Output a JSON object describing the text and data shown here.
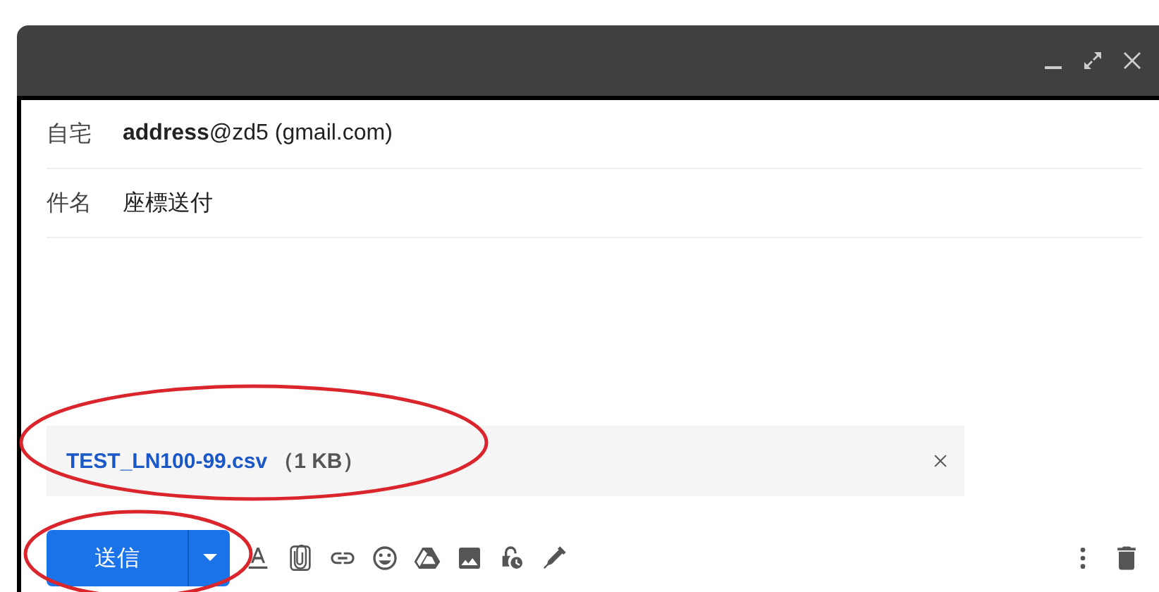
{
  "recipient": {
    "label": "自宅",
    "value": "**address**@zd5 (gmail.com)"
  },
  "subject": {
    "label": "件名",
    "value": "座標送付"
  },
  "attachment": {
    "name": "TEST_LN100-99.csv",
    "size": "（1 KB）"
  },
  "send_button": {
    "label": "送信"
  }
}
